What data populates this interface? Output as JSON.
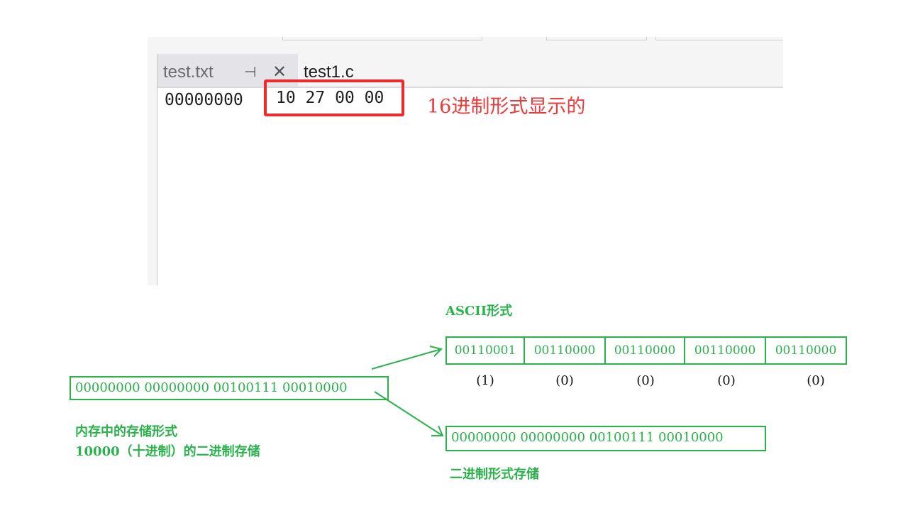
{
  "editor": {
    "tabs": [
      {
        "label": "test.txt",
        "pin_icon": "⊣",
        "close_icon": "✕",
        "active": true
      },
      {
        "label": "test1.c",
        "active": false
      }
    ],
    "offset": "00000000",
    "bytes": "10 27 00 00",
    "note": "16进制形式显示的",
    "colors": {
      "highlight": "#ee2a2a",
      "note": "#ee3a3a"
    }
  },
  "diagram": {
    "memory_box": "00000000 00000000 00100111 00010000",
    "memory_caption_1": "内存中的存储形式",
    "memory_caption_2": "10000（十进制）的二进制存储",
    "ascii_title": "ASCII形式",
    "ascii_cells": [
      {
        "bits": "00110001",
        "char": "(1)"
      },
      {
        "bits": "00110000",
        "char": "(0)"
      },
      {
        "bits": "00110000",
        "char": "(0)"
      },
      {
        "bits": "00110000",
        "char": "(0)"
      },
      {
        "bits": "00110000",
        "char": "(0)"
      }
    ],
    "binary_box": "00000000 00000000 00100111 00010000",
    "binary_caption": "二进制形式存储",
    "colors": {
      "green": "#2bb24c"
    }
  }
}
